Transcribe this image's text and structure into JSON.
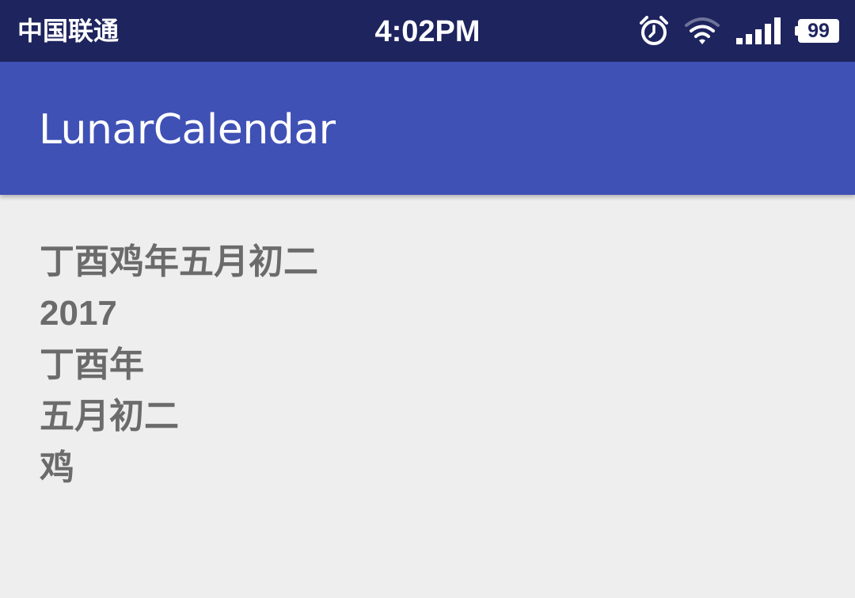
{
  "status_bar": {
    "carrier": "中国联通",
    "time": "4:02PM",
    "battery_level": "99",
    "icons": [
      "alarm-icon",
      "wifi-icon",
      "signal-icon",
      "battery-icon"
    ],
    "background_color": "#1e245e"
  },
  "app_bar": {
    "title": "LunarCalendar",
    "background_color": "#3f51b5"
  },
  "content": {
    "lunar_full_date": "丁酉鸡年五月初二",
    "year": "2017",
    "ganzhi_year": "丁酉年",
    "lunar_month_day": "五月初二",
    "zodiac": "鸡"
  }
}
